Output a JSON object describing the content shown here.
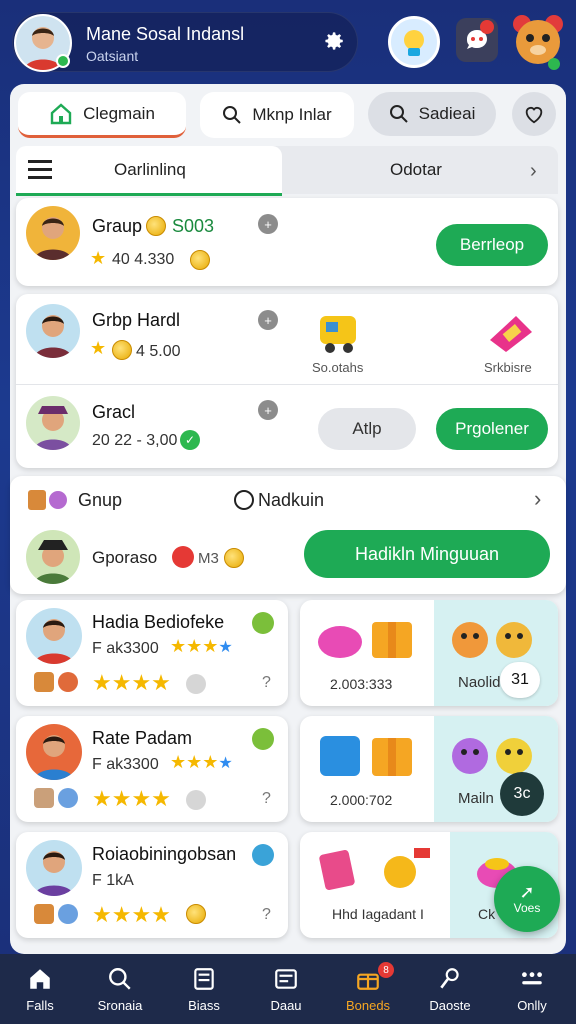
{
  "header": {
    "title": "Mane Sosal Indansl",
    "subtitle": "Oatsiant"
  },
  "top_tabs": [
    {
      "label": "Clegmain"
    },
    {
      "label": "Mknp Inlar"
    },
    {
      "label": "Sadieai"
    }
  ],
  "sub_tabs": {
    "left": "Oarlinlinq",
    "right": "Odotar"
  },
  "row1": {
    "name": "Graup",
    "amount": "S003",
    "stat": "40 4.330",
    "button": "Berrleop"
  },
  "row2": {
    "name": "Grbp Hardl",
    "stat": "4 5.00",
    "item1_label": "So.otahs",
    "item2_label": "Srkbisre"
  },
  "row3": {
    "name": "Gracl",
    "stat": "20 22 - 3,00",
    "button_grey": "Atlp",
    "button_green": "Prgolener"
  },
  "section": {
    "left_label": "Gnup",
    "mid_label": "Nadkuin"
  },
  "promo": {
    "name": "Gporaso",
    "badge": "M3",
    "button": "Hadikln Minguuan"
  },
  "cards": [
    {
      "name": "Hadia Bediofeke",
      "line": "F ak3300"
    },
    {
      "name": "Rate Padam",
      "line": "F ak3300"
    },
    {
      "name": "Roiaobiningobsan",
      "line": "F 1kA"
    }
  ],
  "tiles": [
    {
      "value": "2.003:333",
      "label": "Naolide",
      "count": "31"
    },
    {
      "value": "2.000:702",
      "label": "Mailn",
      "count": "3c"
    },
    {
      "value": "Hhd Iagadant I",
      "label": "Ck",
      "fab": "Voes"
    }
  ],
  "nav": [
    {
      "label": "Falls"
    },
    {
      "label": "Sronaia"
    },
    {
      "label": "Biass"
    },
    {
      "label": "Daau"
    },
    {
      "label": "Boneds"
    },
    {
      "label": "Daoste"
    },
    {
      "label": "Onlly"
    }
  ],
  "nav_badge": "8",
  "colors": {
    "accent": "#1eaa55",
    "bg": "#1c3a8f",
    "highlight": "#f5a623",
    "nav_bg": "#1e2a4a"
  }
}
